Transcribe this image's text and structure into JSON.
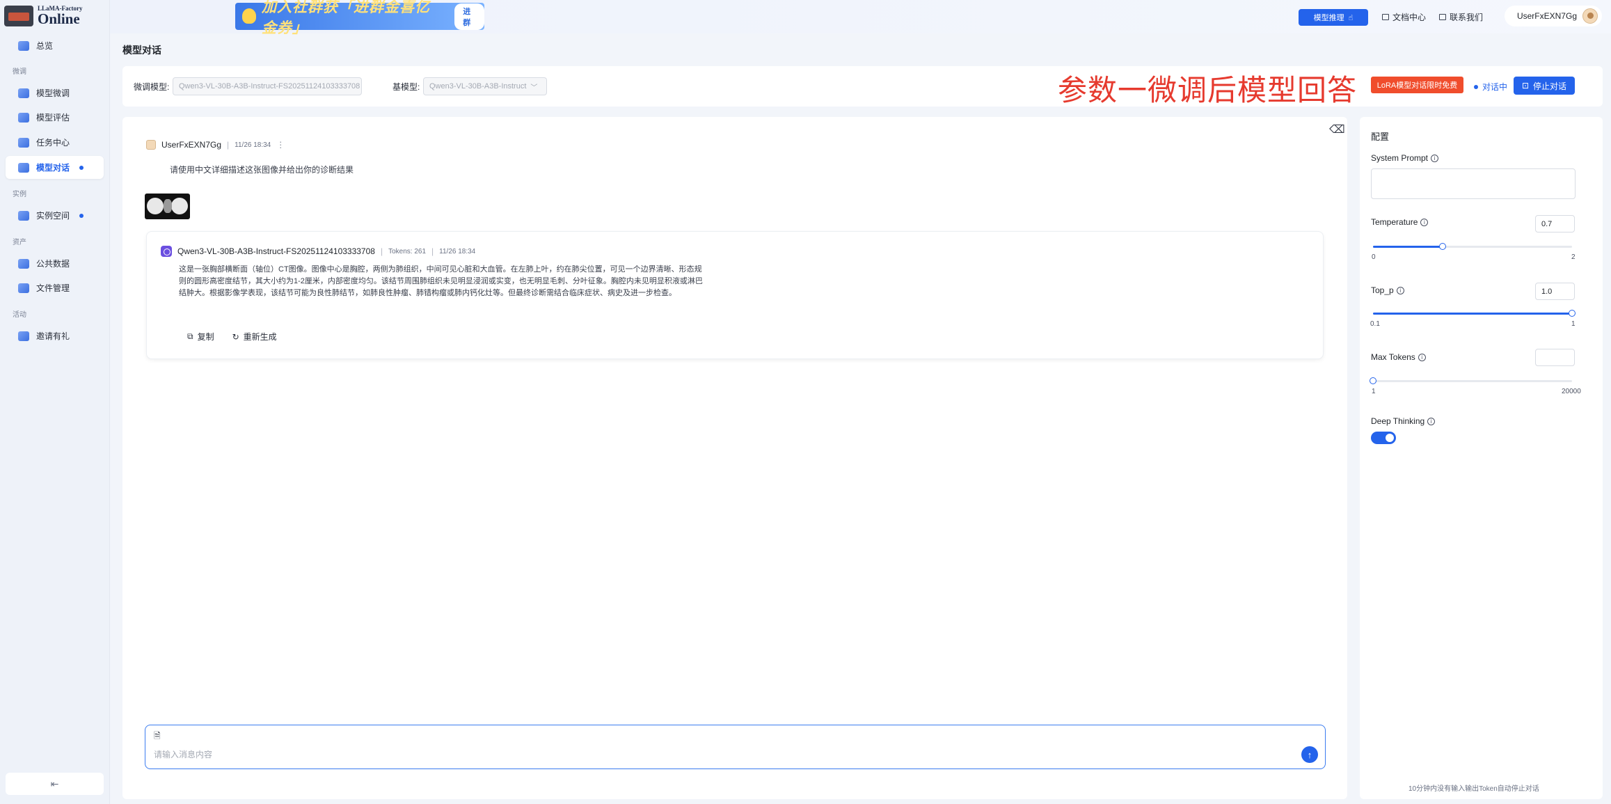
{
  "logo": {
    "top": "LLaMA-Factory",
    "main": "Online"
  },
  "sidebar": {
    "groups": [
      "微调",
      "实例",
      "资产",
      "活动"
    ],
    "items": [
      {
        "label": "总览"
      },
      {
        "label": "模型微调"
      },
      {
        "label": "模型评估"
      },
      {
        "label": "任务中心"
      },
      {
        "label": "模型对话",
        "active": true
      },
      {
        "label": "实例空间"
      },
      {
        "label": "公共数据"
      },
      {
        "label": "文件管理"
      },
      {
        "label": "邀请有礼"
      }
    ],
    "collapse_icon": "collapse-sidebar-icon"
  },
  "header": {
    "banner_text": "加入社群获「进群金喜亿金券」",
    "banner_button": "进群",
    "reason_button": "模型推理",
    "docs_link": "文档中心",
    "contact_link": "联系我们",
    "username": "UserFxEXN7Gg"
  },
  "page": {
    "title": "模型对话"
  },
  "selectors": {
    "finetuned_label": "微调模型:",
    "finetuned_value": "Qwen3-VL-30B-A3B-Instruct-FS20251124103333708",
    "base_label": "基模型:",
    "base_value": "Qwen3-VL-30B-A3B-Instruct"
  },
  "overlay_title": "参数一微调后模型回答",
  "lora_badge": "LoRA模型对话限时免费",
  "status_text": "对话中",
  "stop_button": "停止对话",
  "chat": {
    "user": {
      "name": "UserFxEXN7Gg",
      "time": "11/26 18:34",
      "text": "请使用中文详细描述这张图像并给出你的诊断结果"
    },
    "answer": {
      "model": "Qwen3-VL-30B-A3B-Instruct-FS20251124103333708",
      "tokens": "Tokens: 261",
      "time": "11/26 18:34",
      "text": "这是一张胸部横断面（轴位）CT图像。图像中心是胸腔，两侧为肺组织，中间可见心脏和大血管。在左肺上叶，约在肺尖位置，可见一个边界清晰、形态规则的圆形高密度结节，其大小约为1-2厘米，内部密度均匀。该结节周围肺组织未见明显浸润或实变，也无明显毛刺、分叶征象。胸腔内未见明显积液或淋巴结肿大。根据影像学表现，该结节可能为良性肺结节，如肺良性肿瘤、肺错构瘤或肺内钙化灶等。但最终诊断需结合临床症状、病史及进一步检查。",
      "copy": "复制",
      "regenerate": "重新生成"
    },
    "input_placeholder": "请输入消息内容"
  },
  "config": {
    "title": "配置",
    "system_prompt_label": "System Prompt",
    "system_prompt_value": "",
    "temperature": {
      "label": "Temperature",
      "value": "0.7",
      "min": "0",
      "max": "2",
      "level": 0.35
    },
    "top_p": {
      "label": "Top_p",
      "value": "1.0",
      "min": "0.1",
      "max": "1",
      "level": 1.0
    },
    "max_tokens": {
      "label": "Max Tokens",
      "value": "",
      "min": "1",
      "max": "20000",
      "level": 0.0
    },
    "deep_thinking": {
      "label": "Deep Thinking",
      "enabled": true
    },
    "footnote": "10分钟内没有输入输出Token自动停止对话"
  }
}
